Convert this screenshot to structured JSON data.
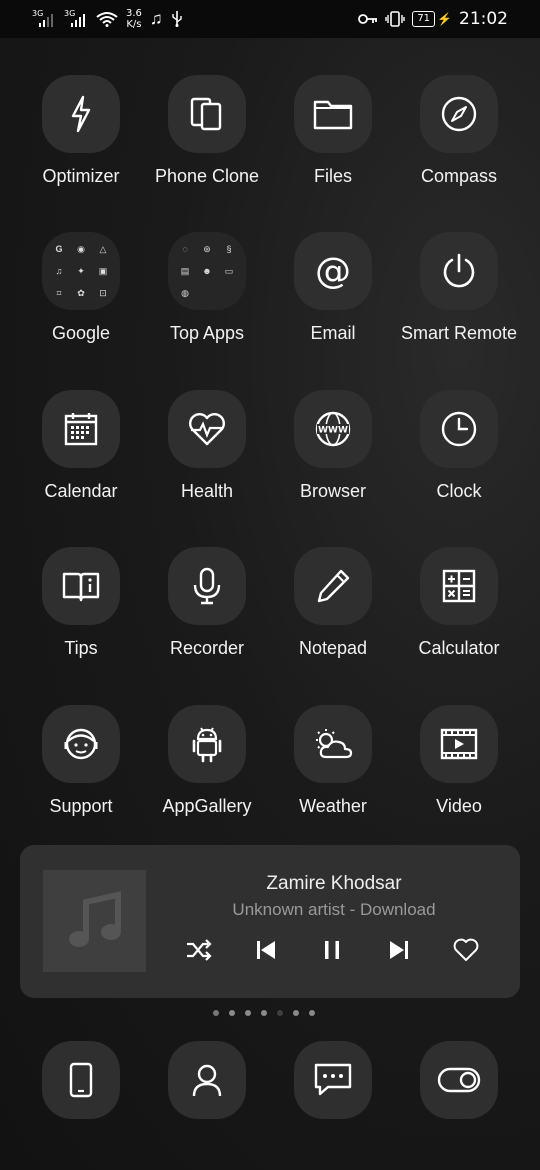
{
  "status_bar": {
    "network1": "3G",
    "network2": "3G",
    "speed_value": "3.6",
    "speed_unit": "K/s",
    "battery": "71",
    "time": "21:02"
  },
  "apps": [
    {
      "label": "Optimizer",
      "icon": "lightning-icon"
    },
    {
      "label": "Phone Clone",
      "icon": "phone-clone-icon"
    },
    {
      "label": "Files",
      "icon": "folder-icon"
    },
    {
      "label": "Compass",
      "icon": "compass-icon"
    },
    {
      "label": "Google",
      "icon": "google-folder-icon"
    },
    {
      "label": "Top Apps",
      "icon": "top-apps-folder-icon"
    },
    {
      "label": "Email",
      "icon": "at-icon"
    },
    {
      "label": "Smart Remote",
      "icon": "power-icon"
    },
    {
      "label": "Calendar",
      "icon": "calendar-icon"
    },
    {
      "label": "Health",
      "icon": "heart-pulse-icon"
    },
    {
      "label": "Browser",
      "icon": "globe-www-icon"
    },
    {
      "label": "Clock",
      "icon": "clock-icon"
    },
    {
      "label": "Tips",
      "icon": "book-icon"
    },
    {
      "label": "Recorder",
      "icon": "microphone-icon"
    },
    {
      "label": "Notepad",
      "icon": "pen-icon"
    },
    {
      "label": "Calculator",
      "icon": "calculator-icon"
    },
    {
      "label": "Support",
      "icon": "support-agent-icon"
    },
    {
      "label": "AppGallery",
      "icon": "android-icon"
    },
    {
      "label": "Weather",
      "icon": "sun-cloud-icon"
    },
    {
      "label": "Video",
      "icon": "film-icon"
    }
  ],
  "music": {
    "title": "Zamire Khodsar",
    "artist": "Unknown artist - Download"
  },
  "page_indicator": {
    "count": 7,
    "current": 5
  },
  "dock": [
    "phone-icon",
    "contacts-icon",
    "messages-icon",
    "toggle-icon"
  ]
}
